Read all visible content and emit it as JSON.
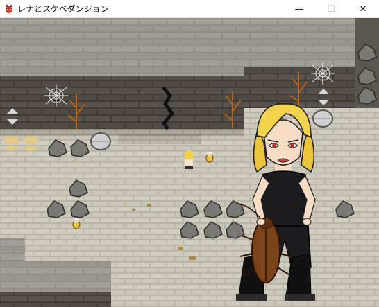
{
  "window": {
    "title": "レナとスケベダンジョン",
    "icon": "red-demon-app-icon",
    "minimize_icon": "minimize-icon",
    "maximize_icon": "maximize-icon",
    "close_icon": "close-icon",
    "minimize_glyph": "—",
    "maximize_glyph": "☐",
    "close_glyph": "✕"
  },
  "game": {
    "scene": "dungeon-floor",
    "player": "rena-character",
    "characters": [
      "rena-sprite-small",
      "bee-sprite-small"
    ],
    "objects": [
      "rock-pile",
      "stone-barrel",
      "spider-web",
      "dead-vine",
      "wall-crack",
      "stairs-marker"
    ],
    "portrait": "rena-portrait-with-cockroach",
    "colors": {
      "floor": "#c9c5b5",
      "wall_top": "#8e8c85",
      "wall_face": "#4a4640",
      "hair": "#f2d24a",
      "outfit": "#1c1c1e"
    }
  }
}
